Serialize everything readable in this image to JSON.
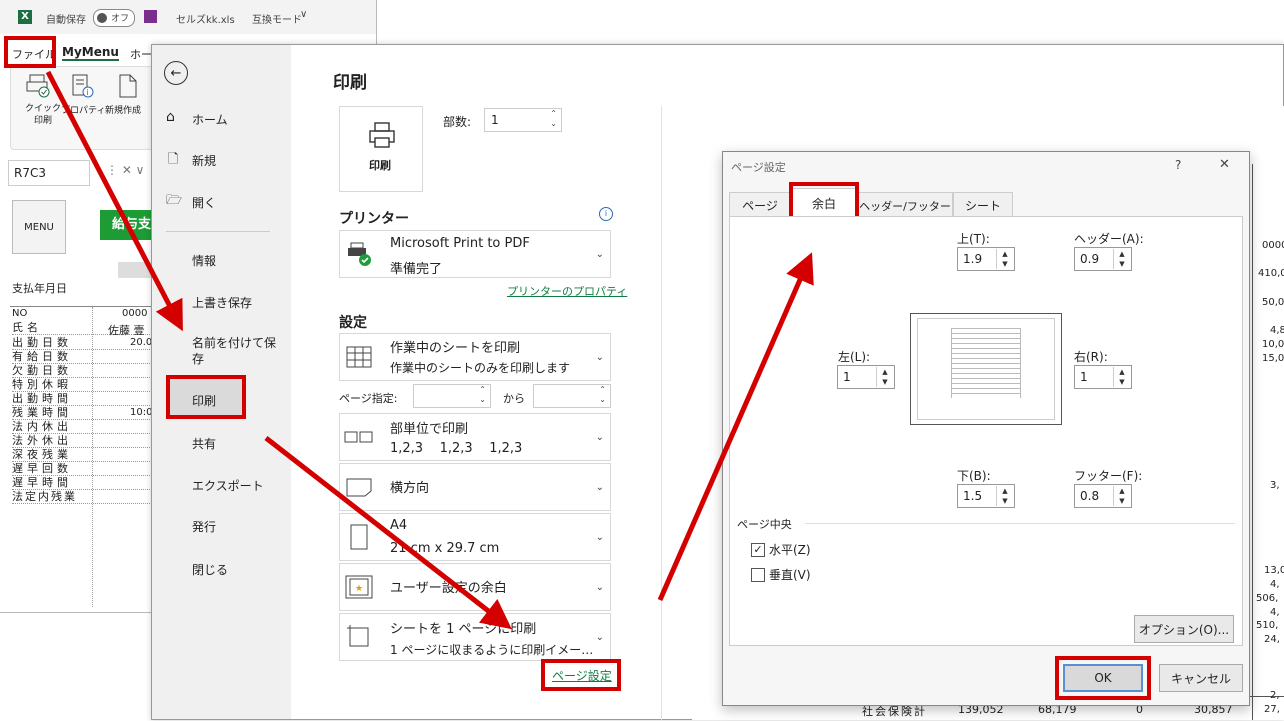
{
  "excel": {
    "autosave_label": "自動保存",
    "autosave_state": "オフ",
    "filename": "セルズkk.xls",
    "mode": "互換モード",
    "menu_file": "ファイル",
    "menu_mymenu": "MyMenu",
    "menu_home": "ホー",
    "ribbon": [
      {
        "label": "クイック\n印刷"
      },
      {
        "label": "プロパティ"
      },
      {
        "label": "新規作成"
      }
    ],
    "name_box": "R7C3",
    "menu_button": "MENU",
    "green_button": "給与支",
    "pay_date_label": "支払年月日",
    "no_label": "NO",
    "no_value": "0000",
    "name_row_label": "氏名",
    "name_value": "佐藤 壹",
    "rows": [
      {
        "label": "出勤日数",
        "value": "20.0"
      },
      {
        "label": "有給日数",
        "value": ""
      },
      {
        "label": "欠勤日数",
        "value": ""
      },
      {
        "label": "特別休暇",
        "value": ""
      },
      {
        "label": "出勤時間",
        "value": ""
      },
      {
        "label": "残業時間",
        "value": "10:0"
      },
      {
        "label": "法内休出",
        "value": ""
      },
      {
        "label": "法外休出",
        "value": ""
      },
      {
        "label": "深夜残業",
        "value": ""
      },
      {
        "label": "遅早回数",
        "value": ""
      },
      {
        "label": "遅早時間",
        "value": ""
      },
      {
        "label": "法定内残業",
        "value": ""
      }
    ]
  },
  "backstage": {
    "nav": [
      {
        "id": "home",
        "label": "ホーム",
        "icon": "home-icon"
      },
      {
        "id": "new",
        "label": "新規",
        "icon": "new-doc-icon"
      },
      {
        "id": "open",
        "label": "開く",
        "icon": "folder-icon"
      },
      {
        "id": "info",
        "label": "情報"
      },
      {
        "id": "save",
        "label": "上書き保存"
      },
      {
        "id": "saveas",
        "label": "名前を付けて保\n存"
      },
      {
        "id": "print",
        "label": "印刷"
      },
      {
        "id": "share",
        "label": "共有"
      },
      {
        "id": "export",
        "label": "エクスポート"
      },
      {
        "id": "publish",
        "label": "発行"
      },
      {
        "id": "close",
        "label": "閉じる"
      }
    ],
    "print": {
      "title": "印刷",
      "print_button": "印刷",
      "copies_label": "部数:",
      "copies_value": "1",
      "printer_title": "プリンター",
      "printer_name": "Microsoft Print to PDF",
      "printer_status": "準備完了",
      "printer_props": "プリンターのプロパティ",
      "settings_title": "設定",
      "opt_sheet_l1": "作業中のシートを印刷",
      "opt_sheet_l2": "作業中のシートのみを印刷します",
      "pages_label": "ページ指定:",
      "pages_to": "から",
      "opt_collate_l1": "部単位で印刷",
      "opt_collate_l2": "1,2,3    1,2,3    1,2,3",
      "opt_orient_l1": "横方向",
      "opt_paper_l1": "A4",
      "opt_paper_l2": "21 cm x 29.7 cm",
      "opt_margin_l1": "ユーザー設定の余白",
      "opt_scale_l1": "シートを 1 ページに印刷",
      "opt_scale_l2": "1 ページに収まるように印刷イメー…",
      "page_setup_link": "ページ設定"
    }
  },
  "dialog": {
    "title": "ページ設定",
    "help": "?",
    "close": "✕",
    "tabs": [
      "ページ",
      "余白",
      "ヘッダー/フッター",
      "シート"
    ],
    "top_label": "上(T):",
    "top_value": "1.9",
    "header_label": "ヘッダー(A):",
    "header_value": "0.9",
    "left_label": "左(L):",
    "left_value": "1",
    "right_label": "右(R):",
    "right_value": "1",
    "bottom_label": "下(B):",
    "bottom_value": "1.5",
    "footer_label": "フッター(F):",
    "footer_value": "0.8",
    "center_title": "ページ中央",
    "horizontal_label": "水平(Z)",
    "horizontal_checked": true,
    "vertical_label": "垂直(V)",
    "vertical_checked": false,
    "options_button": "オプション(O)...",
    "ok_button": "OK",
    "cancel_button": "キャンセル"
  },
  "preview": {
    "right_numbers": [
      "0000",
      "410,0",
      "50,0",
      "4,8",
      "10,0",
      "15,0",
      "3,",
      "13,0",
      "4,",
      "506,",
      "4,",
      "510,",
      "24,",
      "2,",
      "27,"
    ],
    "bottom_row": {
      "label": "社会保険計",
      "v1": "139,052",
      "v2": "68,179",
      "v3": "0",
      "v4": "30,857"
    }
  },
  "colors": {
    "accent_red": "#d40000",
    "link_green": "#107c41",
    "excel_green": "#1d6f42"
  }
}
